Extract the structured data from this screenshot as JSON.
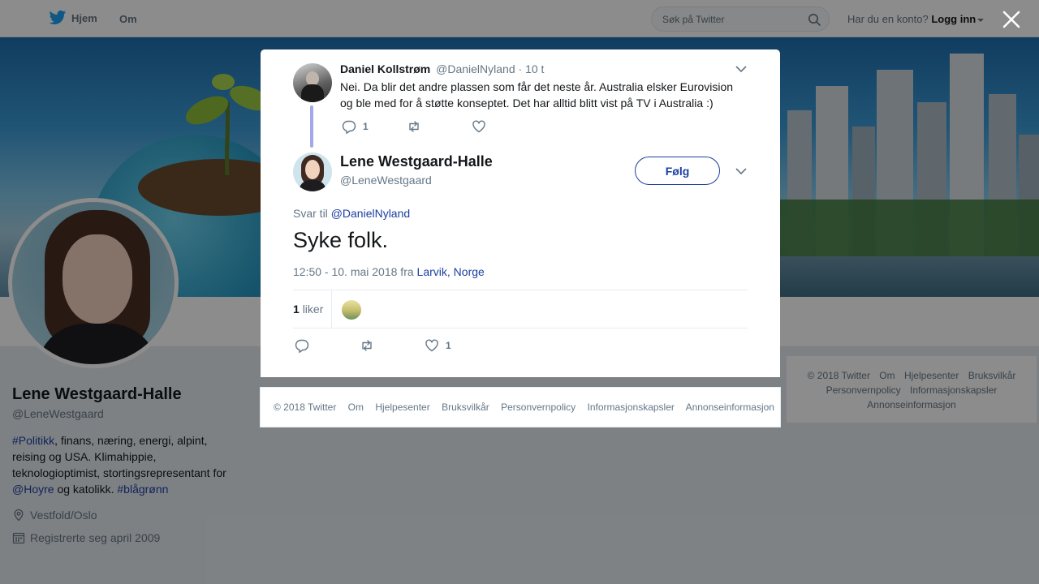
{
  "topbar": {
    "home_label": "Hjem",
    "about_label": "Om",
    "search_placeholder": "Søk på Twitter",
    "account_question": "Har du en konto?",
    "login_label": "Logg inn"
  },
  "profile": {
    "name": "Lene Westgaard-Halle",
    "handle": "@LeneWestgaard",
    "bio": {
      "hashtag1": "#Politikk",
      "text1": ", finans, næring, energi, alpint, reising og USA. Klimahippie, teknologioptimist, stortingsrepresentant for ",
      "mention": "@Hoyre",
      "text2": " og katolikk. ",
      "hashtag2": "#blågrønn"
    },
    "location": "Vestfold/Oslo",
    "joined": "Registrerte seg april 2009"
  },
  "right_footer": {
    "links": [
      "© 2018 Twitter",
      "Om",
      "Hjelpesenter",
      "Bruksvilkår",
      "Personvernpolicy",
      "Informasjonskapsler",
      "Annonseinformasjon"
    ]
  },
  "parent_tweet": {
    "name": "Daniel Kollstrøm",
    "handle": "@DanielNyland",
    "time": "· 10 t",
    "text": "Nei. Da blir det andre plassen som får det neste år. Australia elsker Eurovision og ble med for å støtte konseptet. Det har alltid blitt vist på TV i Australia :)",
    "reply_count": "1"
  },
  "main_tweet": {
    "name": "Lene Westgaard-Halle",
    "handle": "@LeneWestgaard",
    "follow_label": "Følg",
    "reply_prefix": "Svar til",
    "reply_to": "@DanielNyland",
    "text": "Syke folk.",
    "timestamp": "12:50 - 10. mai 2018 fra",
    "location": "Larvik, Norge",
    "likes_count": "1",
    "likes_label": "liker",
    "like_count_action": "1"
  },
  "modal_footer": {
    "links": [
      "© 2018 Twitter",
      "Om",
      "Hjelpesenter",
      "Bruksvilkår",
      "Personvernpolicy",
      "Informasjonskapsler",
      "Annonseinformasjon"
    ]
  },
  "colors": {
    "link": "#1b3fa0",
    "brand": "#1da1f2",
    "overlay": "rgba(0,0,0,0.45)"
  },
  "icons": [
    "twitter-bird-icon",
    "search-icon",
    "close-icon",
    "chevron-down-icon",
    "reply-icon",
    "retweet-icon",
    "heart-icon",
    "location-icon",
    "calendar-icon"
  ]
}
